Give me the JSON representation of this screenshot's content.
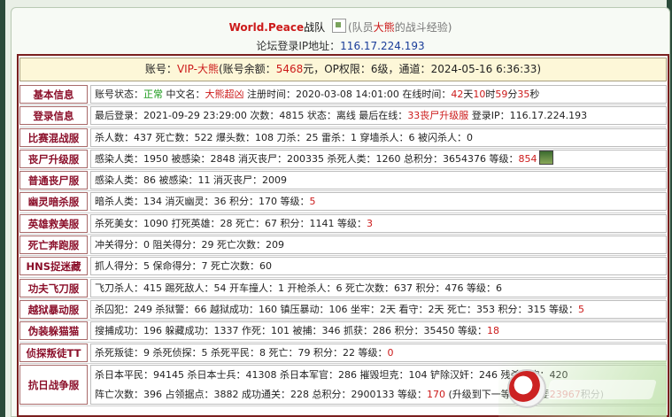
{
  "header": {
    "team_name": "World.Peace",
    "team_suffix": "战队",
    "image_alt_prefix": "(队员",
    "image_alt_highlight": "大熊",
    "image_alt_suffix": "的战斗经验)",
    "ip_label": "论坛登录IP地址：",
    "ip_value": "116.17.224.193"
  },
  "account": {
    "label": "账号：",
    "vip": "VIP-大熊",
    "balance_label": "(账号余额：",
    "balance": "5468",
    "balance_unit": "元，OP权限：",
    "op_level": "6级，通道：",
    "channel_time": "2024-05-16 6:36:33)"
  },
  "rows": [
    {
      "label": "基本信息",
      "parts": [
        {
          "t": "账号状态：",
          "c": ""
        },
        {
          "t": "正常",
          "c": "green"
        },
        {
          "t": " 中文名：",
          "c": ""
        },
        {
          "t": "大熊超凶",
          "c": "red"
        },
        {
          "t": " 注册时间：2020-03-08 14:01:00 在线时间：",
          "c": ""
        },
        {
          "t": "42",
          "c": "red"
        },
        {
          "t": "天",
          "c": ""
        },
        {
          "t": "10",
          "c": "red"
        },
        {
          "t": "时",
          "c": ""
        },
        {
          "t": "59",
          "c": "red"
        },
        {
          "t": "分",
          "c": ""
        },
        {
          "t": "35",
          "c": "red"
        },
        {
          "t": "秒",
          "c": ""
        }
      ]
    },
    {
      "label": "登录信息",
      "parts": [
        {
          "t": "最后登录：2021-09-29 23:29:00 次数：4815 状态：离线 最后在线：",
          "c": ""
        },
        {
          "t": "33丧尸升级服",
          "c": "red"
        },
        {
          "t": " 登录IP：116.17.224.193",
          "c": ""
        }
      ]
    },
    {
      "label": "比赛混战服",
      "parts": [
        {
          "t": "杀人数：437 死亡数：522 爆头数：108 刀杀：25 雷杀：1 穿墙杀人：6 被闪杀人：0",
          "c": ""
        }
      ]
    },
    {
      "label": "丧尸升级服",
      "avatar": true,
      "parts": [
        {
          "t": "感染人类：1950 被感染：2848 消灭丧尸：200335 杀死人类：1260 总积分：3654376 等级：",
          "c": ""
        },
        {
          "t": "854",
          "c": "red"
        }
      ]
    },
    {
      "label": "普通丧尸服",
      "parts": [
        {
          "t": "感染人类：86 被感染：11 消灭丧尸：2009",
          "c": ""
        }
      ]
    },
    {
      "label": "幽灵暗杀服",
      "parts": [
        {
          "t": "暗杀人类：134 消灭幽灵：36 积分：170 等级：",
          "c": ""
        },
        {
          "t": "5",
          "c": "red"
        }
      ]
    },
    {
      "label": "英雄救美服",
      "parts": [
        {
          "t": "杀死美女：1090 打死英雄：28 死亡：67 积分：1141 等级：",
          "c": ""
        },
        {
          "t": "3",
          "c": "red"
        }
      ]
    },
    {
      "label": "死亡奔跑服",
      "parts": [
        {
          "t": "冲关得分：0 阻关得分：29 死亡次数：209",
          "c": ""
        }
      ]
    },
    {
      "label": "HNS捉迷藏",
      "parts": [
        {
          "t": "抓人得分：5 保命得分：7 死亡次数：60",
          "c": ""
        }
      ]
    },
    {
      "label": "功夫飞刀服",
      "parts": [
        {
          "t": "飞刀杀人：415 踢死敌人：54 开车撞人：1 开枪杀人：6 死亡次数：637 积分：476 等级：6",
          "c": ""
        }
      ]
    },
    {
      "label": "越狱暴动服",
      "parts": [
        {
          "t": "杀囚犯：249 杀狱警：66 越狱成功：160 镇压暴动：106 坐牢：2天 看守：2天 死亡：353 积分：315 等级：",
          "c": ""
        },
        {
          "t": "5",
          "c": "red"
        }
      ]
    },
    {
      "label": "伪装躲猫猫",
      "parts": [
        {
          "t": "搜捕成功：196 躲藏成功：1337 作死：101 被捕：346 抓获：286 积分：35450 等级：",
          "c": ""
        },
        {
          "t": "18",
          "c": "red"
        }
      ]
    },
    {
      "label": "侦探叛徒TT",
      "parts": [
        {
          "t": "杀死叛徒：9 杀死侦探：5 杀死平民：8 死亡：79 积分：22 等级：",
          "c": ""
        },
        {
          "t": "0",
          "c": "red"
        }
      ]
    },
    {
      "label": "抗日战争服",
      "tall": true,
      "parts": [
        {
          "t": "杀日本平民：94145 杀日本士兵：41308 杀日本军官：286 摧毁坦克：104 铲除汉奸：246 残杀同胞：420",
          "c": ""
        },
        {
          "t": "阵亡次数：396 占领据点：3882 成功通关：228 总积分：2900133 等级：",
          "c": "br"
        },
        {
          "t": "170",
          "c": "red"
        },
        {
          "t": " (升级到下一等级还需要",
          "c": ""
        },
        {
          "t": "23967",
          "c": "red"
        },
        {
          "t": "积分)",
          "c": ""
        }
      ]
    }
  ]
}
